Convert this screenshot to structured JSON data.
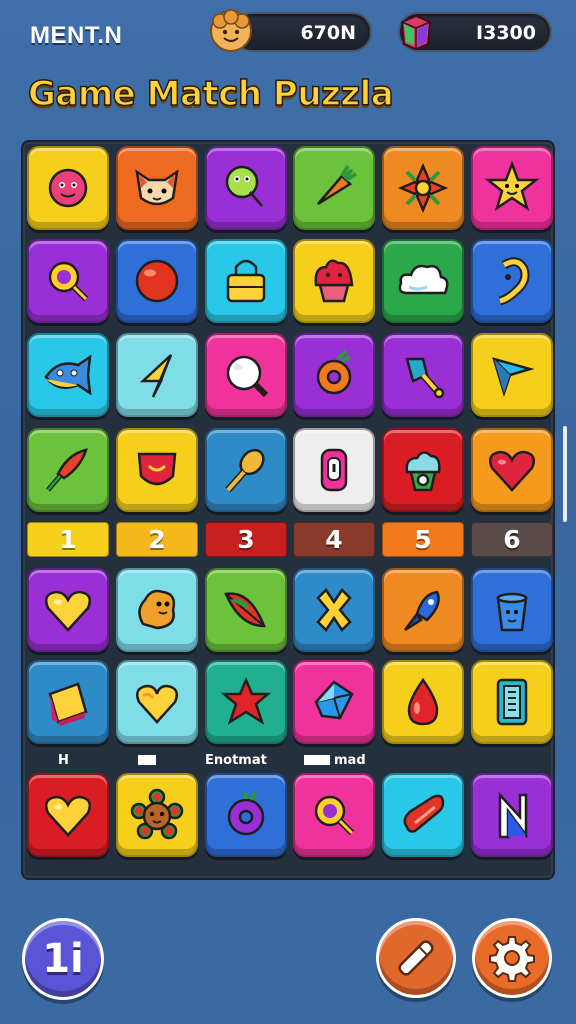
{
  "header": {
    "menu_label": "MENT.N",
    "lives_value": "670N",
    "gems_value": "I3300",
    "face_icon": "smiling-face-icon",
    "gem_icon": "gem-icon"
  },
  "title": "Game Match Puzzla",
  "colors": {
    "yellow": "#f5cf1c",
    "orange": "#ef6a22",
    "purple": "#9a2fd6",
    "green": "#6cc23a",
    "pink": "#f0329c",
    "blue": "#2f6fd8",
    "cyan": "#29c8e8",
    "teal": "#20b090",
    "red": "#d81e24",
    "lightcyan": "#7fdde8",
    "white": "#eeeeee"
  },
  "grid_rows": [
    [
      {
        "color": "#f5cf1c",
        "icon": "pink-blob-monster-icon"
      },
      {
        "color": "#ef6a22",
        "icon": "cat-face-icon"
      },
      {
        "color": "#9a2fd6",
        "icon": "green-lollipop-icon"
      },
      {
        "color": "#6cc23a",
        "icon": "carrot-icon"
      },
      {
        "color": "#ef8a22",
        "icon": "red-flower-icon"
      },
      {
        "color": "#f0329c",
        "icon": "yellow-star-face-icon"
      }
    ],
    [
      {
        "color": "#9a2fd6",
        "icon": "magnifier-icon"
      },
      {
        "color": "#2f6fd8",
        "icon": "red-ball-icon"
      },
      {
        "color": "#29c8e8",
        "icon": "yellow-bag-icon"
      },
      {
        "color": "#f5cf1c",
        "icon": "red-muffin-icon"
      },
      {
        "color": "#2aa84a",
        "icon": "cloud-icon"
      },
      {
        "color": "#2f6fd8",
        "icon": "yellow-hook-icon"
      }
    ],
    [
      {
        "color": "#29c8e8",
        "icon": "blue-fish-icon"
      },
      {
        "color": "#7fdde8",
        "icon": "yellow-arrow-icon"
      },
      {
        "color": "#f0329c",
        "icon": "white-magnifier-icon"
      },
      {
        "color": "#9a2fd6",
        "icon": "orange-donut-icon"
      },
      {
        "color": "#9a2fd6",
        "icon": "key-icon"
      },
      {
        "color": "#f5cf1c",
        "icon": "blue-pointer-icon"
      }
    ],
    [
      {
        "color": "#6cc23a",
        "icon": "leaf-pen-icon"
      },
      {
        "color": "#f5cf1c",
        "icon": "red-heart-shield-icon"
      },
      {
        "color": "#2f8ac8",
        "icon": "spoon-icon"
      },
      {
        "color": "#eeeeee",
        "icon": "pink-lock-icon"
      },
      {
        "color": "#d81e24",
        "icon": "cup-cake-icon"
      },
      {
        "color": "#f59a1c",
        "icon": "red-heart-icon"
      }
    ]
  ],
  "number_strips": [
    {
      "label": "1",
      "color": "#f5cf1c"
    },
    {
      "label": "2",
      "color": "#f5b81c"
    },
    {
      "label": "3",
      "color": "#c8201e"
    },
    {
      "label": "4",
      "color": "#8a3a2a"
    },
    {
      "label": "5",
      "color": "#f07a1c"
    },
    {
      "label": "6",
      "color": "#5a4a48"
    }
  ],
  "grid_rows_lower": [
    [
      {
        "color": "#9a2fd6",
        "icon": "yellow-heart-icon"
      },
      {
        "color": "#7fdde8",
        "icon": "orange-bear-icon"
      },
      {
        "color": "#6cc23a",
        "icon": "red-leaf-icon"
      },
      {
        "color": "#2f8ac8",
        "icon": "yellow-cross-icon"
      },
      {
        "color": "#ef8a22",
        "icon": "blue-rocket-icon"
      },
      {
        "color": "#2f6fd8",
        "icon": "blue-bucket-icon"
      }
    ],
    [
      {
        "color": "#2f8ac8",
        "icon": "yellow-box-icon"
      },
      {
        "color": "#7fdde8",
        "icon": "orange-heart-icon"
      },
      {
        "color": "#20b090",
        "icon": "red-star-icon"
      },
      {
        "color": "#f0329c",
        "icon": "blue-gem-icon"
      },
      {
        "color": "#f5cf1c",
        "icon": "red-drop-icon"
      },
      {
        "color": "#f5cf1c",
        "icon": "thermometer-card-icon"
      }
    ],
    [
      {
        "color": "#d81e24",
        "icon": "yellow-heart-icon"
      },
      {
        "color": "#f5cf1c",
        "icon": "flower-bear-icon"
      },
      {
        "color": "#2f6fd8",
        "icon": "purple-donut-icon"
      },
      {
        "color": "#f0329c",
        "icon": "magnifier-icon"
      },
      {
        "color": "#29c8e8",
        "icon": "red-sausage-icon"
      },
      {
        "color": "#9a2fd6",
        "icon": "flag-icon"
      }
    ]
  ],
  "row_labels": [
    {
      "text": "H"
    },
    {
      "text": ""
    },
    {
      "text": "Enotmat"
    },
    {
      "text": "mad"
    },
    {
      "text": ""
    }
  ],
  "buttons": {
    "level_label": "1i",
    "tool_icon": "pencil-icon",
    "settings_icon": "gear-icon"
  }
}
